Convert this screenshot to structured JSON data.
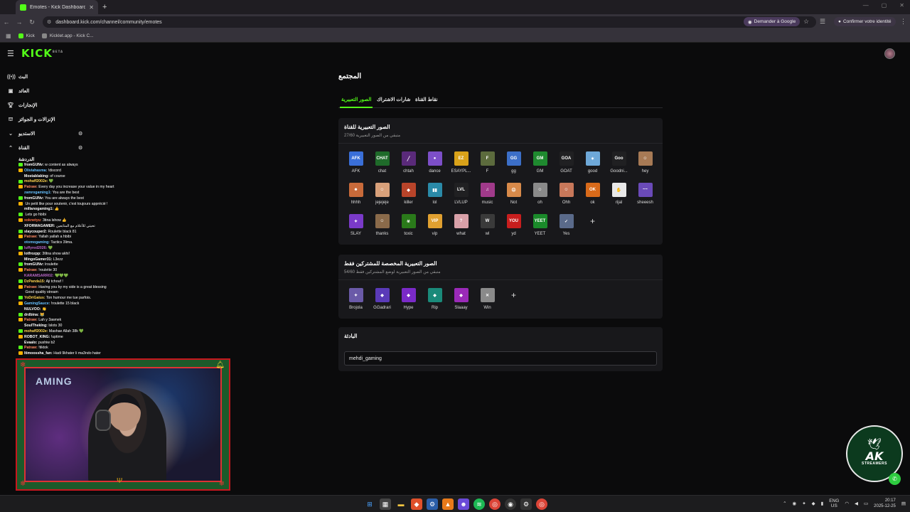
{
  "browser": {
    "tab_title": "Emotes - Kick Dashboard",
    "url": "dashboard.kick.com/channel/community/emotes",
    "ask_google": "Demander à Google",
    "confirm_identity": "Confirmer votre identité",
    "bookmarks": [
      "Kick",
      "Kicklet.app - Kick C..."
    ]
  },
  "brand": {
    "logo": "KICK",
    "logo_sup": "BETA",
    "accent": "#53fc18"
  },
  "sidebar": {
    "items": [
      {
        "label": "البث",
        "icon": "broadcast-icon"
      },
      {
        "label": "العائد",
        "icon": "revenue-icon"
      },
      {
        "label": "الإنجازات",
        "icon": "trophy-icon"
      },
      {
        "label": "الإنزالات و الجوائز",
        "icon": "drops-icon"
      },
      {
        "label": "الاستديو",
        "icon": "chevron-down-icon"
      },
      {
        "label": "القناة",
        "icon": "chevron-up-icon"
      }
    ]
  },
  "chat": {
    "title": "الدردشة",
    "lines": [
      {
        "user": "fromGUNv:",
        "text": "w content as always",
        "color": "#ffffff"
      },
      {
        "user": "Oliviahasma:",
        "text": "!discord",
        "color": "#66c0ff"
      },
      {
        "user": "Mostablaking:",
        "text": "of course",
        "color": "#ffffff"
      },
      {
        "user": "mohaff2002e:",
        "text": "💚",
        "color": "#ffd54f"
      },
      {
        "user": "Patraw:",
        "text": "Every day you increase your value in my heart",
        "color": "#ff8a65"
      },
      {
        "user": "zamrogaming1:",
        "text": "You are the best",
        "color": "#66c0ff"
      },
      {
        "user": "fromGUNv:",
        "text": "You are always the best",
        "color": "#ffffff"
      },
      {
        "user": "",
        "text": "Un petit like pour soutenir, c'est toujours apprécié !",
        "color": "#ffffff"
      },
      {
        "user": "millanogaming1:",
        "text": "👍",
        "color": "#ffffff"
      },
      {
        "user": "",
        "text": "Lets go hbibi",
        "color": "#ffffff"
      },
      {
        "user": "xoknetyu:",
        "text": "3tina lshow 👍",
        "color": "#ff7043"
      },
      {
        "user": "XFORMAGAMER:",
        "text": "تحيتي للأعلام مع المتابعين",
        "color": "#ffffff"
      },
      {
        "user": "slaycouper2:",
        "text": "Roulette black 81",
        "color": "#ffffff"
      },
      {
        "user": "Patraw:",
        "text": "Yallah yallah a hbibi",
        "color": "#ff8a65"
      },
      {
        "user": "otomogaming:",
        "text": "Tactics 3lima.",
        "color": "#66c0ff"
      },
      {
        "user": "luffyred2026:",
        "text": "💚",
        "color": "#ba68c8"
      },
      {
        "user": "lotfrozpp:",
        "text": "3tltna show akhi!",
        "color": "#ffffff"
      },
      {
        "user": "MingoGamer31:",
        "text": "L3ezz",
        "color": "#ffffff"
      },
      {
        "user": "fromGUNv:",
        "text": "lroulette",
        "color": "#ffffff"
      },
      {
        "user": "Patraw:",
        "text": "!roulette 30",
        "color": "#ff8a65"
      },
      {
        "user": "KARAMSARR02:",
        "text": "💚💚💚",
        "color": "#ba68c8"
      },
      {
        "user": "DzPanda15:",
        "text": "Aji tchouf !",
        "color": "#ffd54f"
      },
      {
        "user": "Patraw:",
        "text": "Having you by my side is a great blessing",
        "color": "#ff8a65"
      },
      {
        "user": "",
        "text": "Good quality stream",
        "color": "#ffffff"
      },
      {
        "user": "YoDriGaius:",
        "text": "Ton humour me tue parfois.",
        "color": "#ffd54f"
      },
      {
        "user": "GamingSauce:",
        "text": "!roulette 15 black",
        "color": "#66c0ff"
      },
      {
        "user": "NULVOO:",
        "text": "👏",
        "color": "#ffffff"
      },
      {
        "user": "drdbina:",
        "text": "😹",
        "color": "#ffffff"
      },
      {
        "user": "Patraw:",
        "text": "Lah y 3awnek",
        "color": "#ff8a65"
      },
      {
        "user": "SoulThekIng:",
        "text": "lslots 30",
        "color": "#ffffff"
      },
      {
        "user": "mohaff2002e:",
        "text": "Mashae Allah 38k 💚",
        "color": "#ffd54f"
      },
      {
        "user": "ROBOT_KING:",
        "text": "!uptime",
        "color": "#ffffff"
      },
      {
        "user": "Evaalo:",
        "text": "pushiw b2",
        "color": "#ffffff"
      },
      {
        "user": "Patraw:",
        "text": "!tiktok",
        "color": "#ff8a65"
      },
      {
        "user": "Itimoossha_fan:",
        "text": "Hadi 9khater li ma3ndo hater",
        "color": "#ffffff"
      }
    ]
  },
  "webcam": {
    "brand": "AMING"
  },
  "main": {
    "page_title": "المجتمع",
    "tabs": [
      "الصور التعبيرية",
      "شارات الاشتراك",
      "نقاط القناة"
    ],
    "channel_card": {
      "title": "الصور التعبيرية للقناة",
      "subtitle": "متبقي من الصور التعبيرية 27/60",
      "emotes": [
        {
          "name": "AFK",
          "color": "#3a6fd8",
          "glyph": "AFK"
        },
        {
          "name": "chat",
          "color": "#1f6b2a",
          "glyph": "CHAT"
        },
        {
          "name": "chtah",
          "color": "#5a2a7a",
          "glyph": "╱"
        },
        {
          "name": "dance",
          "color": "#7d4fc8",
          "glyph": "●"
        },
        {
          "name": "ESAYPL...",
          "color": "#d9a21a",
          "glyph": "EZ"
        },
        {
          "name": "F",
          "color": "#5c6b3d",
          "glyph": "F"
        },
        {
          "name": "gg",
          "color": "#3c6fc8",
          "glyph": "GG"
        },
        {
          "name": "GM",
          "color": "#1f8a2f",
          "glyph": "GM"
        },
        {
          "name": "GOAT",
          "color": "#202022",
          "glyph": "GOA"
        },
        {
          "name": "good",
          "color": "#6ea8d8",
          "glyph": "✶"
        },
        {
          "name": "Goodni...",
          "color": "#202022",
          "glyph": "Goo"
        },
        {
          "name": "hey",
          "color": "#a77a55",
          "glyph": "☺"
        },
        {
          "name": "hhhh",
          "color": "#c86a3a",
          "glyph": "☻"
        },
        {
          "name": "jejejeje",
          "color": "#d8a07a",
          "glyph": "☺"
        },
        {
          "name": "killer",
          "color": "#b8442a",
          "glyph": "◆"
        },
        {
          "name": "lol",
          "color": "#2a8aa8",
          "glyph": "▮▮"
        },
        {
          "name": "LVLUP",
          "color": "#202022",
          "glyph": "LVL"
        },
        {
          "name": "music",
          "color": "#a03a8a",
          "glyph": "♫"
        },
        {
          "name": "Not",
          "color": "#d88a4a",
          "glyph": "☹"
        },
        {
          "name": "oh",
          "color": "#8a8a8a",
          "glyph": "☺"
        },
        {
          "name": "Ohh",
          "color": "#c8785a",
          "glyph": "☺"
        },
        {
          "name": "ok",
          "color": "#d86a1a",
          "glyph": "OK"
        },
        {
          "name": "rijal",
          "color": "#e8e8e8",
          "glyph": "✋"
        },
        {
          "name": "sheeesh",
          "color": "#6a4ab8",
          "glyph": "~~"
        },
        {
          "name": "SLAY",
          "color": "#7a3ac8",
          "glyph": "✦"
        },
        {
          "name": "thanks",
          "color": "#8a6a4a",
          "glyph": "☺"
        },
        {
          "name": "toxic",
          "color": "#2a7a1a",
          "glyph": "☣"
        },
        {
          "name": "vip",
          "color": "#e0a030",
          "glyph": "VIP"
        },
        {
          "name": "what",
          "color": "#d8a0a8",
          "glyph": "?"
        },
        {
          "name": "wl",
          "color": "#3a3a3a",
          "glyph": "W"
        },
        {
          "name": "yd",
          "color": "#c81e1e",
          "glyph": "YOU"
        },
        {
          "name": "YEET",
          "color": "#1a8a2a",
          "glyph": "YEET"
        },
        {
          "name": "Yes",
          "color": "#5a6a8a",
          "glyph": "✓"
        }
      ]
    },
    "sub_card": {
      "title": "الصور التعبيرية المخصصة للمشتركين فقط",
      "subtitle": "متبقي من الصور التعبيرية لوضع المشتركين فقط 54/60",
      "emotes": [
        {
          "name": "Brojola",
          "color": "#6a5aa8",
          "glyph": "✦"
        },
        {
          "name": "GGadrari",
          "color": "#5a3ab8",
          "glyph": "◆"
        },
        {
          "name": "Hype",
          "color": "#7a2ac8",
          "glyph": "◆"
        },
        {
          "name": "Rip",
          "color": "#1a8a7a",
          "glyph": "◆"
        },
        {
          "name": "Slaaay",
          "color": "#9a2ab8",
          "glyph": "◆"
        },
        {
          "name": "Win",
          "color": "#8a8a8a",
          "glyph": "✕"
        }
      ]
    },
    "data_card": {
      "title": "البادئة",
      "input_value": "mehdi_gaming"
    }
  },
  "watermark": {
    "letters": "AK",
    "sub": "STREAMERS"
  },
  "taskbar": {
    "lang_top": "ENG",
    "lang_bottom": "US",
    "time": "20:17",
    "date": "2025-12-25"
  }
}
